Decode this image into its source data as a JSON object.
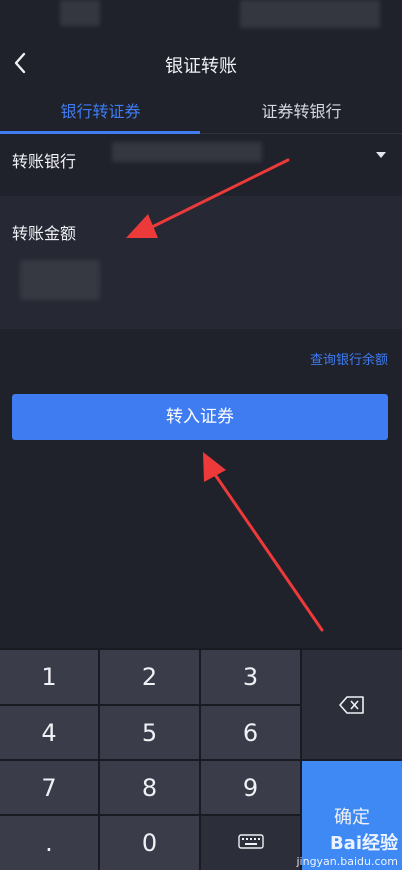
{
  "header": {
    "title": "银证转账"
  },
  "tabs": [
    {
      "label": "银行转证券",
      "active": true
    },
    {
      "label": "证券转银行",
      "active": false
    }
  ],
  "bank": {
    "label": "转账银行"
  },
  "amount": {
    "label": "转账金额",
    "value": ""
  },
  "query_link": "查询银行余额",
  "submit_label": "转入证券",
  "keypad": {
    "keys": [
      "1",
      "2",
      "3",
      "4",
      "5",
      "6",
      "7",
      "8",
      "9",
      ".",
      "0"
    ],
    "confirm_label": "确定",
    "backspace_icon": "backspace-icon",
    "keyboard_icon": "keyboard-icon"
  },
  "watermark": {
    "brand": "Bai经验",
    "url": "jingyan.baidu.com"
  },
  "colors": {
    "accent": "#3f7cf2",
    "background": "#1f212b",
    "arrow": "#ec3a3a"
  }
}
